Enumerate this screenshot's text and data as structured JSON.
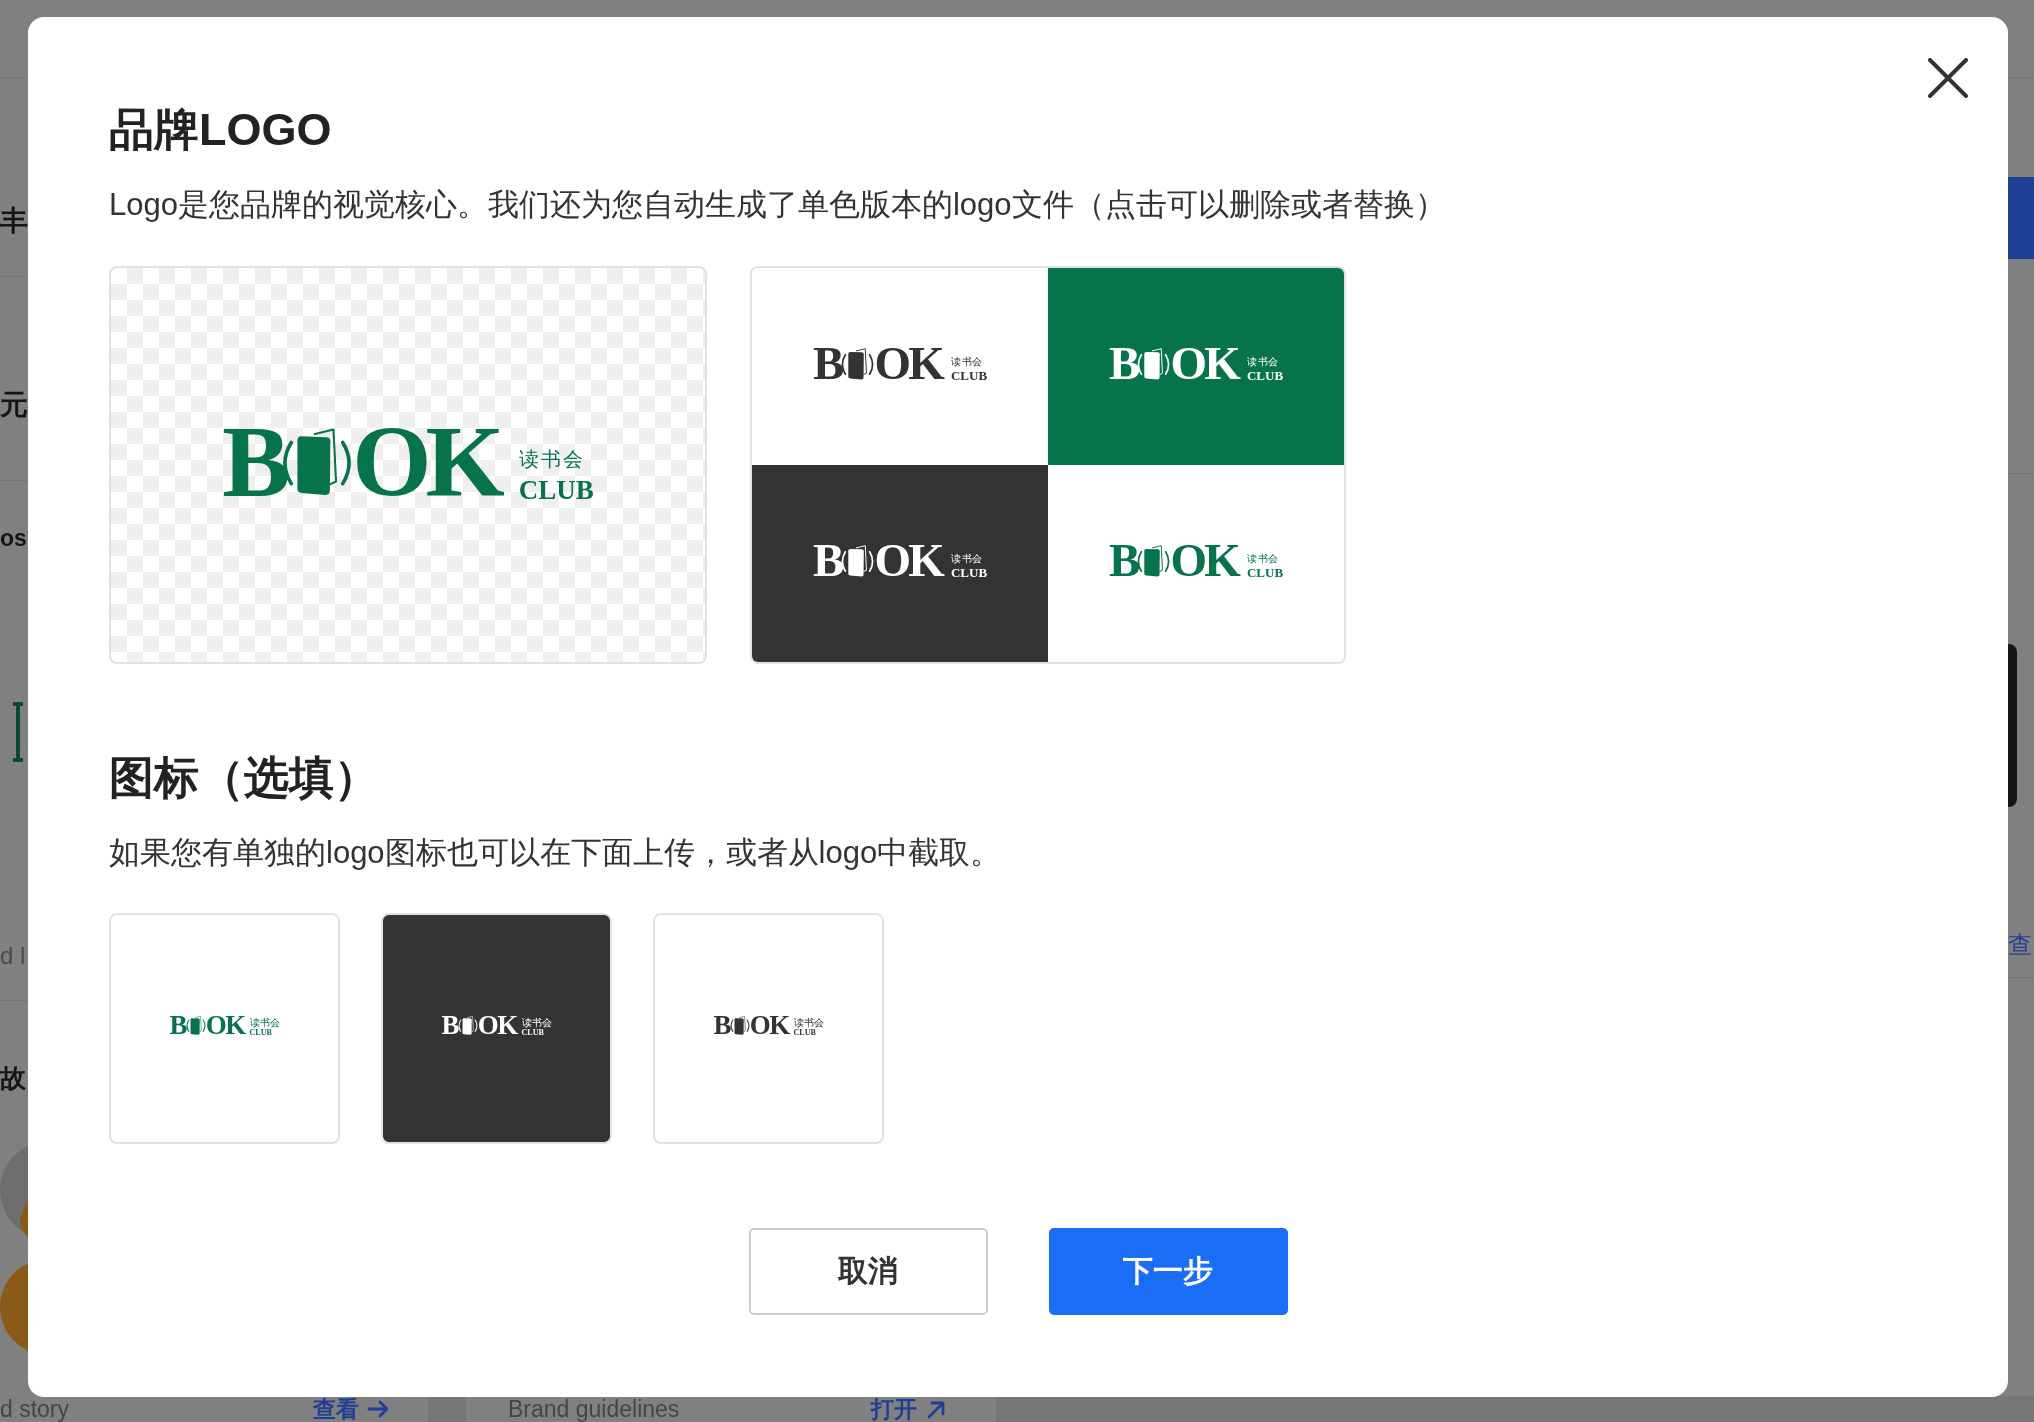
{
  "background_page": {
    "left_edge": [
      {
        "heading": "丰"
      },
      {
        "heading": "元"
      },
      {
        "title": "os",
        "caption": "d l"
      },
      {
        "title": "故"
      }
    ],
    "right_edge": {
      "link": "查"
    },
    "bottom_cards": [
      {
        "title": "d story",
        "action": "查看",
        "kind": "view"
      },
      {
        "title": "Brand guidelines",
        "action": "打开",
        "kind": "open"
      }
    ]
  },
  "dialog": {
    "title": "品牌LOGO",
    "description": "Logo是您品牌的视觉核心。我们还为您自动生成了单色版本的logo文件（点击可以删除或者替换）",
    "preview": {
      "kind": "transparent",
      "logo": {
        "mark_left": "B",
        "mark_right": "OK",
        "name_cn": "读书会",
        "name_en": "CLUB"
      }
    },
    "variants": [
      {
        "kind": "mono",
        "logo": {
          "mark_left": "B",
          "mark_right": "OK",
          "name_cn": "读书会",
          "name_en": "CLUB"
        }
      },
      {
        "kind": "brand",
        "logo": {
          "mark_left": "B",
          "mark_right": "OK",
          "name_cn": "读书会",
          "name_en": "CLUB"
        }
      },
      {
        "kind": "knockout",
        "logo": {
          "mark_left": "B",
          "mark_right": "OK",
          "name_cn": "读书会",
          "name_en": "CLUB"
        }
      },
      {
        "kind": "color",
        "logo": {
          "mark_left": "B",
          "mark_right": "OK",
          "name_cn": "读书会",
          "name_en": "CLUB"
        }
      }
    ],
    "icon_section": {
      "title": "图标（选填）",
      "description": "如果您有单独的logo图标也可以在下面上传，或者从logo中截取。",
      "icons": [
        {
          "kind": "color",
          "logo": {
            "mark_left": "B",
            "mark_right": "OK",
            "name_cn": "读书会",
            "name_en": "CLUB"
          }
        },
        {
          "kind": "knockout",
          "logo": {
            "mark_left": "B",
            "mark_right": "OK",
            "name_cn": "读书会",
            "name_en": "CLUB"
          }
        },
        {
          "kind": "mono",
          "logo": {
            "mark_left": "B",
            "mark_right": "OK",
            "name_cn": "读书会",
            "name_en": "CLUB"
          }
        }
      ]
    },
    "buttons": [
      {
        "label": "取消",
        "kind": "secondary"
      },
      {
        "label": "下一步",
        "kind": "primary"
      }
    ]
  }
}
